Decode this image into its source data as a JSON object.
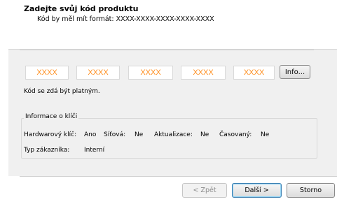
{
  "header": {
    "title": "Zadejte svůj kód produktu",
    "subtitle": "Kód by měl mít formát: XXXX-XXXX-XXXX-XXXX-XXXX"
  },
  "key_fields": [
    {
      "value": "XXXX"
    },
    {
      "value": "XXXX"
    },
    {
      "value": "XXXX"
    },
    {
      "value": "XXXX"
    },
    {
      "value": "XXXX"
    }
  ],
  "info_button": "Info...",
  "validation_status": "Kód se zdá být platným.",
  "key_info": {
    "group_label": "Informace o klíči",
    "hardware_label": "Hardwarový klíč:",
    "hardware_value": "Ano",
    "network_label": "Síťová:",
    "network_value": "Ne",
    "updates_label": "Aktualizace:",
    "updates_value": "Ne",
    "timed_label": "Časovaný:",
    "timed_value": "Ne",
    "customer_type_label": "Typ zákazníka:",
    "customer_type_value": "Interní"
  },
  "buttons": {
    "back": "< Zpět",
    "next": "Další >",
    "cancel": "Storno"
  },
  "colors": {
    "key_text": "#ff8c1a",
    "panel_bg": "#f0f0f0"
  }
}
